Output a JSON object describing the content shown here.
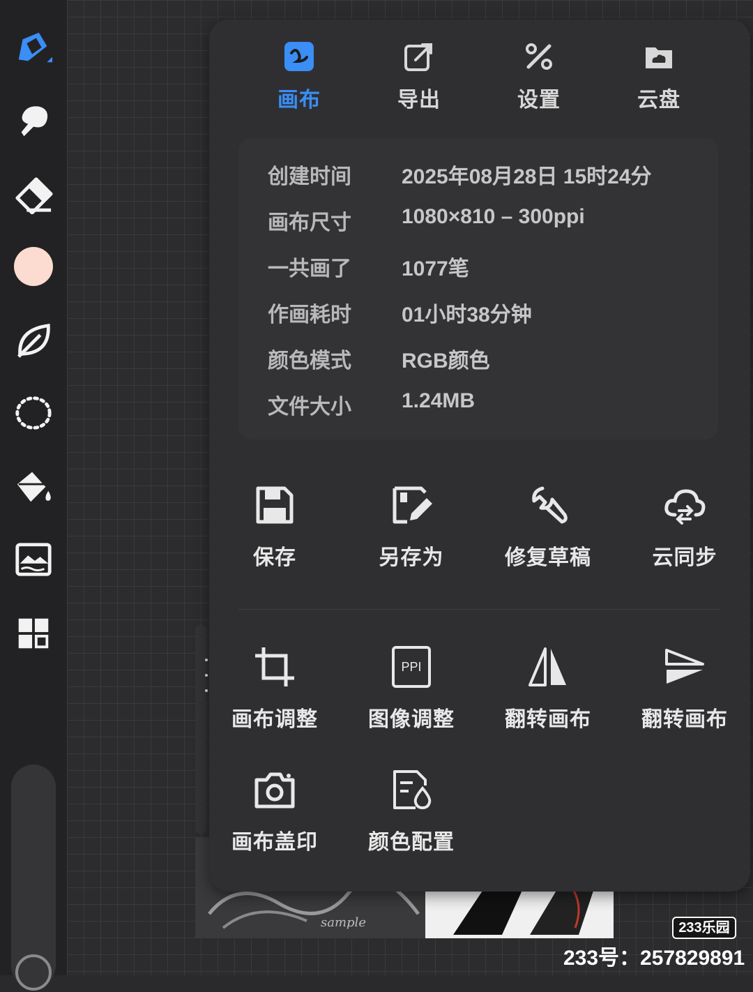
{
  "colors": {
    "accent": "#3a8ef6",
    "panel_bg": "#2f2f32",
    "info_box_bg": "#333336",
    "toolbar_bg": "#222224",
    "current_brush_color": "#fcdcd0"
  },
  "toolbar": {
    "tools": [
      {
        "name": "pen-tool",
        "icon": "pen-icon",
        "active": true
      },
      {
        "name": "smudge-tool",
        "icon": "smudge-icon"
      },
      {
        "name": "eraser-tool",
        "icon": "eraser-icon"
      },
      {
        "name": "color-picker",
        "icon": "color-swatch"
      },
      {
        "name": "leaf-brush-tool",
        "icon": "leaf-icon"
      },
      {
        "name": "lasso-tool",
        "icon": "lasso-icon"
      },
      {
        "name": "fill-tool",
        "icon": "paint-bucket-icon"
      },
      {
        "name": "image-tool",
        "icon": "image-icon"
      },
      {
        "name": "layers-tool",
        "icon": "grid-icon"
      }
    ]
  },
  "tabs": [
    {
      "label": "画布",
      "icon": "canvas-icon",
      "active": true
    },
    {
      "label": "导出",
      "icon": "export-icon"
    },
    {
      "label": "设置",
      "icon": "settings-icon"
    },
    {
      "label": "云盘",
      "icon": "cloud-drive-icon"
    }
  ],
  "info": [
    {
      "key": "创建时间",
      "value": "2025年08月28日 15时24分"
    },
    {
      "key": "画布尺寸",
      "value": "1080×810 – 300ppi"
    },
    {
      "key": "一共画了",
      "value": "1077笔"
    },
    {
      "key": "作画耗时",
      "value": "01小时38分钟"
    },
    {
      "key": "颜色模式",
      "value": "RGB颜色"
    },
    {
      "key": "文件大小",
      "value": "1.24MB"
    }
  ],
  "actions_row1": [
    {
      "label": "保存",
      "icon": "save-icon"
    },
    {
      "label": "另存为",
      "icon": "save-as-icon"
    },
    {
      "label": "修复草稿",
      "icon": "wrench-icon"
    },
    {
      "label": "云同步",
      "icon": "cloud-sync-icon"
    }
  ],
  "actions_row2": [
    {
      "label": "画布调整",
      "icon": "crop-icon"
    },
    {
      "label": "图像调整",
      "icon": "ppi-icon",
      "icon_text": "PPI"
    },
    {
      "label": "翻转画布",
      "icon": "flip-horizontal-icon"
    },
    {
      "label": "翻转画布",
      "icon": "flip-vertical-icon"
    }
  ],
  "actions_row3": [
    {
      "label": "画布盖印",
      "icon": "camera-icon"
    },
    {
      "label": "颜色配置",
      "icon": "color-profile-icon"
    }
  ],
  "preview": {
    "sample_text": "sample"
  },
  "watermark": {
    "badge": "233乐园",
    "id_text": "233号：257829891"
  }
}
